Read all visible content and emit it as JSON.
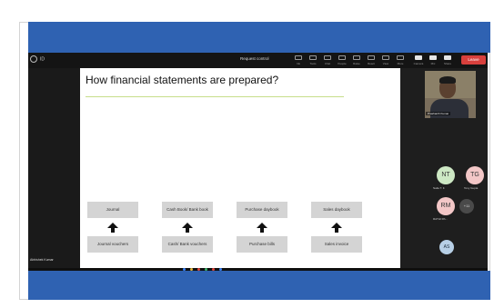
{
  "toolbar": {
    "meeting_id": "ID",
    "request_control": "Request control",
    "tools": [
      "Ink",
      "Tools",
      "Chat",
      "People",
      "Raise",
      "React",
      "View",
      "More",
      "Camera",
      "Mic",
      "Share"
    ],
    "leave": "Leave"
  },
  "slide": {
    "title": "How financial statements are prepared?",
    "top_row": [
      "Journal",
      "Cash Book/ Bank book",
      "Purchase daybook",
      "Sales daybook"
    ],
    "bottom_row": [
      "Journal vouchers",
      "Cash/ Bank vouchers",
      "Purchase bills",
      "Sales invoice"
    ]
  },
  "presenter_label": "Abhishek Kumar",
  "participants": {
    "video_tag": "Prashanth Kumar",
    "avatars": [
      {
        "initials": "NT",
        "label": "Naila T. F.",
        "color": "#cde8c4"
      },
      {
        "initials": "TG",
        "label": "Tony Gupta",
        "color": "#f3c7c7"
      },
      {
        "initials": "RM",
        "label": "RATHI Rh...",
        "color": "#f3c7c7"
      }
    ],
    "more": "+11",
    "bottom_avatar": "AS"
  },
  "colors": {
    "band": "#2f62b2",
    "leave": "#d8403d",
    "rule": "#c7dd8a"
  }
}
